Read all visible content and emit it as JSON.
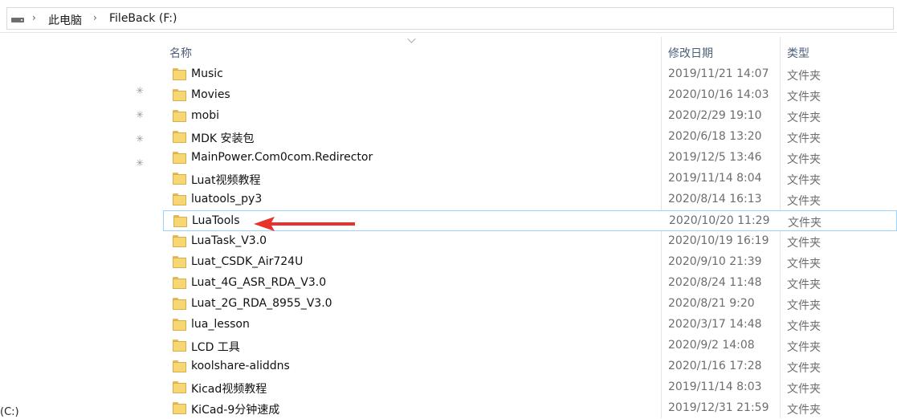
{
  "address": {
    "crumbs": [
      "此电脑",
      "FileBack (F:)"
    ],
    "separator": "›"
  },
  "columns": {
    "name": "名称",
    "date": "修改日期",
    "type": "类型"
  },
  "files": [
    {
      "name": "Music",
      "date": "2019/11/21 14:07",
      "type": "文件夹"
    },
    {
      "name": "Movies",
      "date": "2020/10/16 14:03",
      "type": "文件夹"
    },
    {
      "name": "mobi",
      "date": "2020/2/29 19:10",
      "type": "文件夹"
    },
    {
      "name": "MDK 安装包",
      "date": "2020/6/18 13:20",
      "type": "文件夹"
    },
    {
      "name": "MainPower.Com0com.Redirector",
      "date": "2019/12/5 13:46",
      "type": "文件夹"
    },
    {
      "name": "Luat视频教程",
      "date": "2019/11/14 8:04",
      "type": "文件夹"
    },
    {
      "name": "luatools_py3",
      "date": "2020/8/14 16:13",
      "type": "文件夹"
    },
    {
      "name": "LuaTools",
      "date": "2020/10/20 11:29",
      "type": "文件夹",
      "selected": true
    },
    {
      "name": "LuaTask_V3.0",
      "date": "2020/10/19 16:19",
      "type": "文件夹"
    },
    {
      "name": "Luat_CSDK_Air724U",
      "date": "2020/9/10 21:39",
      "type": "文件夹"
    },
    {
      "name": "Luat_4G_ASR_RDA_V3.0",
      "date": "2020/8/24 11:48",
      "type": "文件夹"
    },
    {
      "name": "Luat_2G_RDA_8955_V3.0",
      "date": "2020/8/21 9:20",
      "type": "文件夹"
    },
    {
      "name": "lua_lesson",
      "date": "2020/3/17 14:48",
      "type": "文件夹"
    },
    {
      "name": "LCD 工具",
      "date": "2020/9/2 14:08",
      "type": "文件夹"
    },
    {
      "name": "koolshare-aliddns",
      "date": "2020/1/16 17:28",
      "type": "文件夹"
    },
    {
      "name": "Kicad视频教程",
      "date": "2019/11/14 8:03",
      "type": "文件夹"
    },
    {
      "name": "KiCad-9分钟速成",
      "date": "2019/12/31 21:59",
      "type": "文件夹"
    }
  ],
  "sidebar_partial_text": "(C:)",
  "colors": {
    "selection_border": "#99d1ff",
    "folder": "#f7d674",
    "arrow": "#e8322d"
  },
  "icons": {
    "pin": "pin-icon",
    "folder": "folder-icon",
    "drive": "drive-icon"
  }
}
